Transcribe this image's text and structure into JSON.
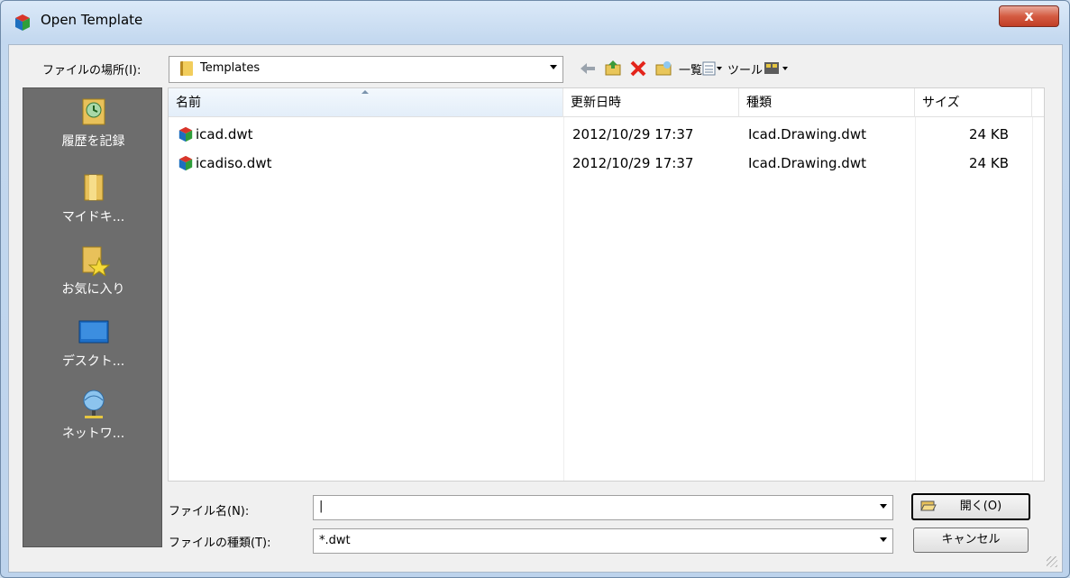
{
  "window": {
    "title": "Open Template",
    "close_label": "x"
  },
  "lookin": {
    "label": "ファイルの場所(I):",
    "value": "Templates"
  },
  "toolbar": {
    "list_label": "一覧",
    "tools_label": "ツール"
  },
  "places": [
    {
      "label": "履歴を記録",
      "icon": "history-icon"
    },
    {
      "label": "マイドキ...",
      "icon": "my-documents-icon"
    },
    {
      "label": "お気に入り",
      "icon": "favorites-icon"
    },
    {
      "label": "デスクト...",
      "icon": "desktop-icon"
    },
    {
      "label": "ネットワ...",
      "icon": "network-icon"
    }
  ],
  "columns": {
    "name": "名前",
    "date": "更新日時",
    "type": "種類",
    "size": "サイズ"
  },
  "files": [
    {
      "name": "icad.dwt",
      "date": "2012/10/29 17:37",
      "type": "Icad.Drawing.dwt",
      "size": "24 KB"
    },
    {
      "name": "icadiso.dwt",
      "date": "2012/10/29 17:37",
      "type": "Icad.Drawing.dwt",
      "size": "24 KB"
    }
  ],
  "filename": {
    "label": "ファイル名(N):",
    "value": "|"
  },
  "filetype": {
    "label": "ファイルの種類(T):",
    "value": "*.dwt"
  },
  "buttons": {
    "open": "開く(O)",
    "cancel": "キャンセル"
  },
  "colors": {
    "close": "#c94a32",
    "places_bg": "#6d6d6d",
    "titlebar": "#c3d8ef"
  }
}
